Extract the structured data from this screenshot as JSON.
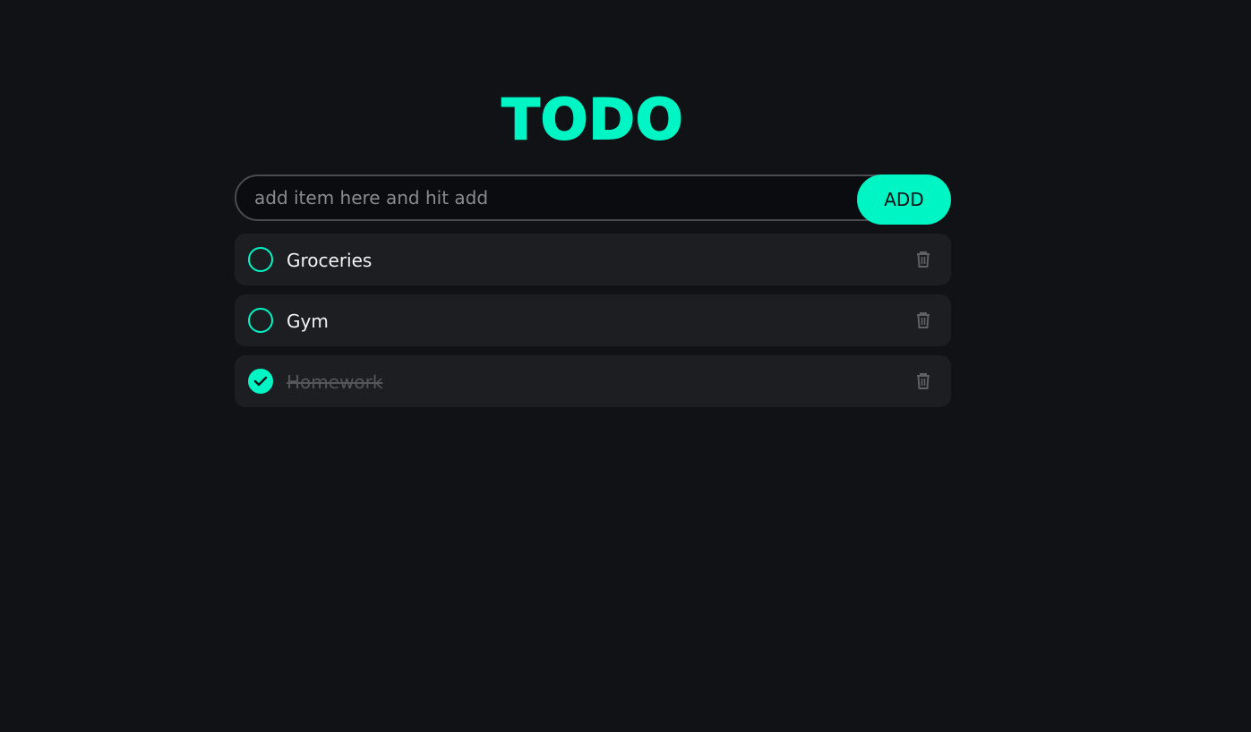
{
  "app": {
    "title": "TODO"
  },
  "input": {
    "placeholder": "add item here and hit add",
    "value": ""
  },
  "add_button": {
    "label": "ADD"
  },
  "items": [
    {
      "label": "Groceries",
      "completed": false
    },
    {
      "label": "Gym",
      "completed": false
    },
    {
      "label": "Homework",
      "completed": true
    }
  ],
  "icons": {
    "check": "check-icon",
    "delete": "trash-icon"
  },
  "colors": {
    "accent": "#00f5c4",
    "background": "#111216",
    "item_background": "#1d1e22",
    "completed_text": "#55565b"
  }
}
